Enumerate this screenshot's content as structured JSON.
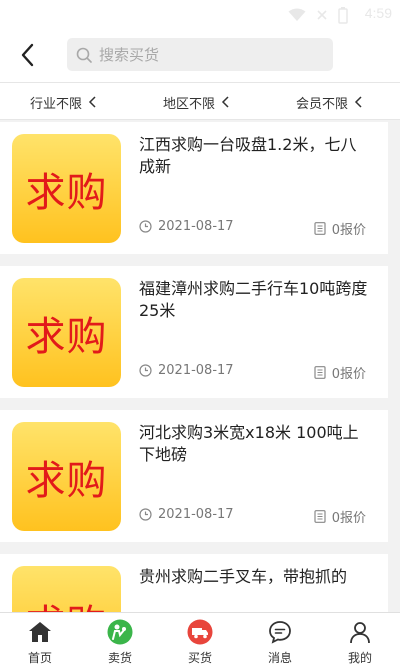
{
  "status": {
    "time": "4:59"
  },
  "search": {
    "placeholder": "搜索买货"
  },
  "filters": [
    {
      "label": "行业不限"
    },
    {
      "label": "地区不限"
    },
    {
      "label": "会员不限"
    }
  ],
  "thumb_text": "求购",
  "posts": [
    {
      "title": "江西求购一台吸盘1.2米，七八成新",
      "date": "2021-08-17",
      "quotes": "0报价"
    },
    {
      "title": "福建漳州求购二手行车10吨跨度25米",
      "date": "2021-08-17",
      "quotes": "0报价"
    },
    {
      "title": "河北求购3米宽x18米 100吨上下地磅",
      "date": "2021-08-17",
      "quotes": "0报价"
    },
    {
      "title": "贵州求购二手叉车，带抱抓的",
      "date": "",
      "quotes": ""
    }
  ],
  "tabs": [
    {
      "label": "首页",
      "icon": "home-icon"
    },
    {
      "label": "卖货",
      "icon": "seller-icon",
      "color": "#3bb54a"
    },
    {
      "label": "买货",
      "icon": "truck-icon",
      "color": "#e8453c"
    },
    {
      "label": "消息",
      "icon": "message-icon"
    },
    {
      "label": "我的",
      "icon": "person-icon"
    }
  ]
}
